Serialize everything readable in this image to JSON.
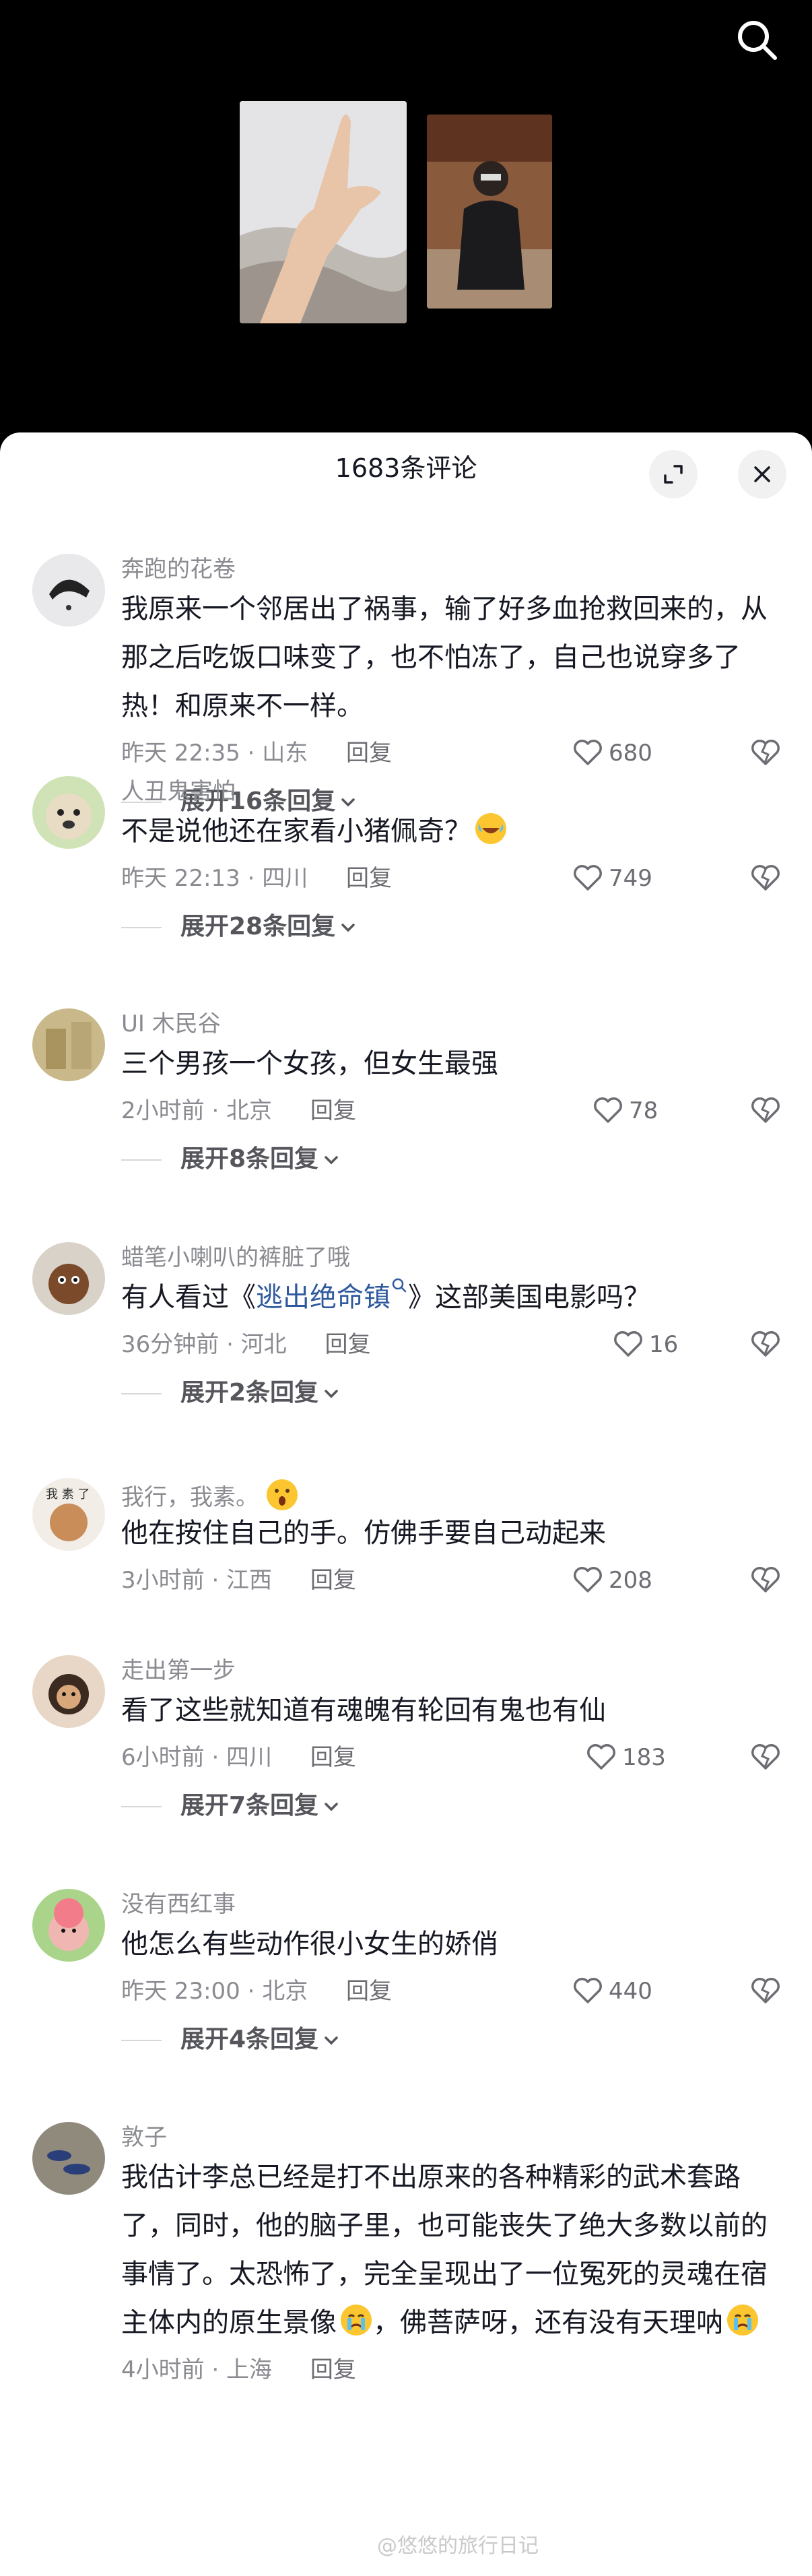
{
  "header": {
    "comment_count_title": "1683条评论"
  },
  "comments": [
    {
      "username": "奔跑的花卷",
      "text": "我原来一个邻居出了祸事，输了好多血抢救回来的，从那之后吃饭口味变了，也不怕冻了，自己也说穿多了热！和原来不一样。",
      "time_location": "昨天 22:35 · 山东",
      "reply_label": "回复",
      "likes": "680",
      "expand_label": "展开16条回复"
    },
    {
      "username": "人丑鬼害怕",
      "text": "不是说他还在家看小猪佩奇？",
      "time_location": "昨天 22:13 · 四川",
      "reply_label": "回复",
      "likes": "749",
      "expand_label": "展开28条回复"
    },
    {
      "username": "UI 木民谷",
      "text": "三个男孩一个女孩，但女生最强",
      "time_location": "2小时前 · 北京",
      "reply_label": "回复",
      "likes": "78",
      "expand_label": "展开8条回复"
    },
    {
      "username": "蜡笔小喇叭的裤脏了哦",
      "text_before": "有人看过《",
      "text_link": "逃出绝命镇",
      "text_after": "》这部美国电影吗？",
      "time_location": "36分钟前 · 河北",
      "reply_label": "回复",
      "likes": "16",
      "expand_label": "展开2条回复"
    },
    {
      "username": "我行，我素。",
      "text": "他在按住自己的手。仿佛手要自己动起来",
      "time_location": "3小时前 · 江西",
      "reply_label": "回复",
      "likes": "208"
    },
    {
      "username": "走出第一步",
      "text": "看了这些就知道有魂魄有轮回有鬼也有仙",
      "time_location": "6小时前 · 四川",
      "reply_label": "回复",
      "likes": "183",
      "expand_label": "展开7条回复"
    },
    {
      "username": "没有西红事",
      "text": "他怎么有些动作很小女生的娇俏",
      "time_location": "昨天 23:00 · 北京",
      "reply_label": "回复",
      "likes": "440",
      "expand_label": "展开4条回复"
    },
    {
      "username": "敦子",
      "text": "我估计李总已经是打不出原来的各种精彩的武术套路了，同时，他的脑子里，也可能丧失了绝大多数以前的事情了。太恐怖了，完全呈现出了一位冤死的灵魂在宿主体内的原生景像",
      "text_middle": "，佛菩萨呀，还有没有天理呐",
      "time_location": "4小时前 · 上海",
      "reply_label": "回复"
    }
  ],
  "watermark": "@悠悠的旅行日记",
  "icons": {
    "search": "search-icon",
    "expand": "expand-arrows-icon",
    "close": "close-icon",
    "like": "heart-outline-icon",
    "dislike": "broken-heart-icon",
    "chevron": "chevron-down-icon"
  },
  "colors": {
    "link": "#2f5a9e",
    "text": "#161823",
    "muted": "#8a8b91"
  }
}
